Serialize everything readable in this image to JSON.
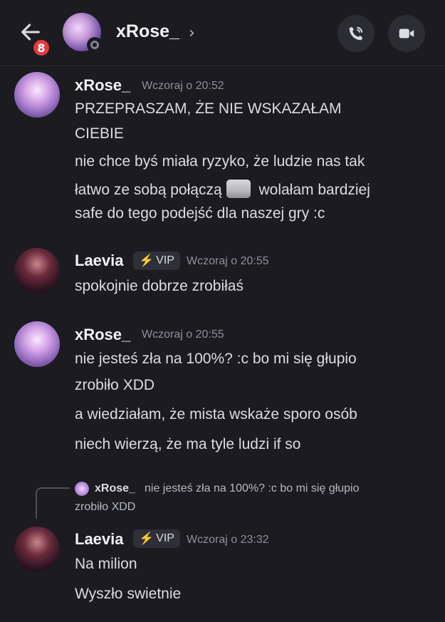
{
  "header": {
    "back_icon": "arrow-left-icon",
    "unread_badge": "8",
    "title": "xRose_",
    "title_chevron": "›",
    "status": "offline",
    "call_icon": "phone-call-icon",
    "video_icon": "video-camera-icon"
  },
  "messages": [
    {
      "author": "xRose_",
      "time": "Wczoraj o 20:52",
      "lines": [
        "PRZEPRASZAM, ŻE NIE WSKAZAŁAM",
        "CIEBIE",
        "nie chce byś miała ryzyko, że ludzie nas tak",
        "łatwo ze sobą połączą",
        "wolałam bardziej",
        "safe do tego podejść dla naszej gry :c"
      ],
      "emoji": "cat-sticker"
    },
    {
      "author": "Laevia",
      "vip": "VIP",
      "time": "Wczoraj o 20:55",
      "lines": [
        "spokojnie dobrze zrobiłaś"
      ]
    },
    {
      "author": "xRose_",
      "time": "Wczoraj o 20:55",
      "lines": [
        "nie jesteś zła na 100%? :c bo mi się głupio",
        "zrobiło XDD",
        "a wiedziałam, że mista wskaże sporo osób",
        "niech wierzą, że ma tyle ludzi if so"
      ]
    },
    {
      "reply": {
        "author": "xRose_",
        "text": "nie jesteś zła na 100%? :c bo mi się głupio",
        "text2": "zrobiło XDD"
      },
      "author": "Laevia",
      "vip": "VIP",
      "time": "Wczoraj o 23:32",
      "lines": [
        "Na milion",
        "Wyszło swietnie"
      ]
    }
  ],
  "colors": {
    "background": "#1b1b20",
    "badge": "#e23c3c",
    "bolt": "#f5c542"
  }
}
